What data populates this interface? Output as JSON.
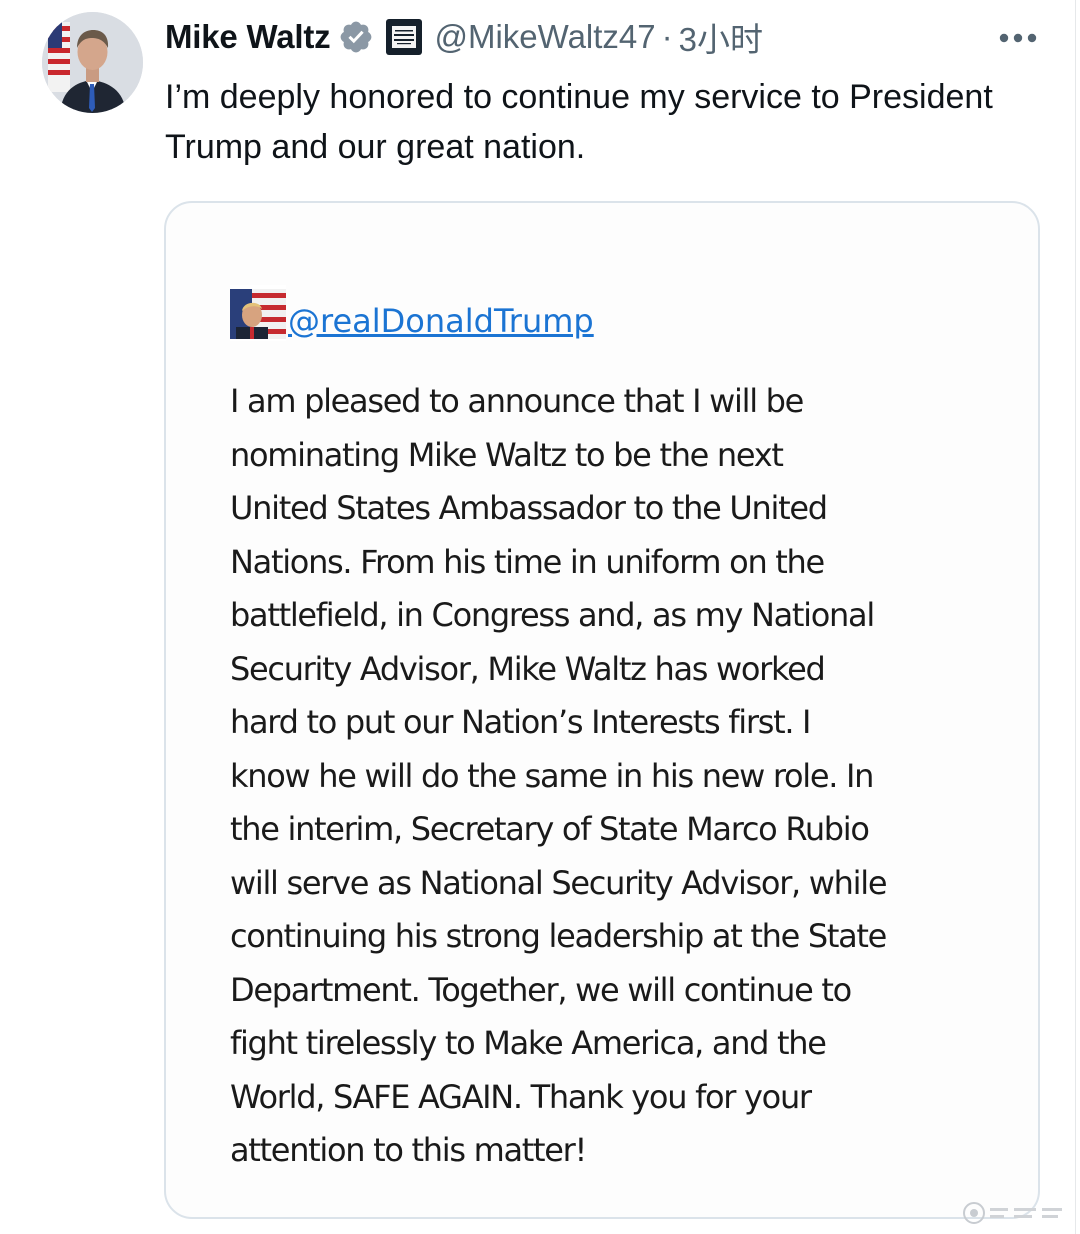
{
  "tweet": {
    "author": {
      "display_name": "Mike Waltz",
      "handle": "@MikeWaltz47",
      "verified_icon": "verified-badge-icon",
      "affiliation_icon": "white-house-badge-icon"
    },
    "separator": "·",
    "timestamp": "3小时",
    "menu_icon": "more-options-icon",
    "text": "I’m deeply honored to continue my service to President Trump and our great nation."
  },
  "quoted_post": {
    "handle": "@realDonaldTrump",
    "body": "I am pleased to announce that I will be\nnominating Mike Waltz to be the next\nUnited States Ambassador to the United\nNations. From his time in uniform on the\nbattlefield, in Congress and, as my National\nSecurity Advisor, Mike Waltz has worked\nhard to put our Nation’s Interests first. I\nknow he will do the same in his new role. In\nthe interim, Secretary of State Marco Rubio\nwill serve as National Security Advisor, while\ncontinuing his strong leadership at the State\nDepartment. Together, we will continue to\nfight tirelessly to Make America, and the\nWorld, SAFE AGAIN. Thank you for your\nattention to this matter!"
  },
  "colors": {
    "text": "#0f1419",
    "secondary": "#536471",
    "verified": "#8b98a5",
    "link": "#1b74d3",
    "card_border": "#dbe3ea"
  }
}
